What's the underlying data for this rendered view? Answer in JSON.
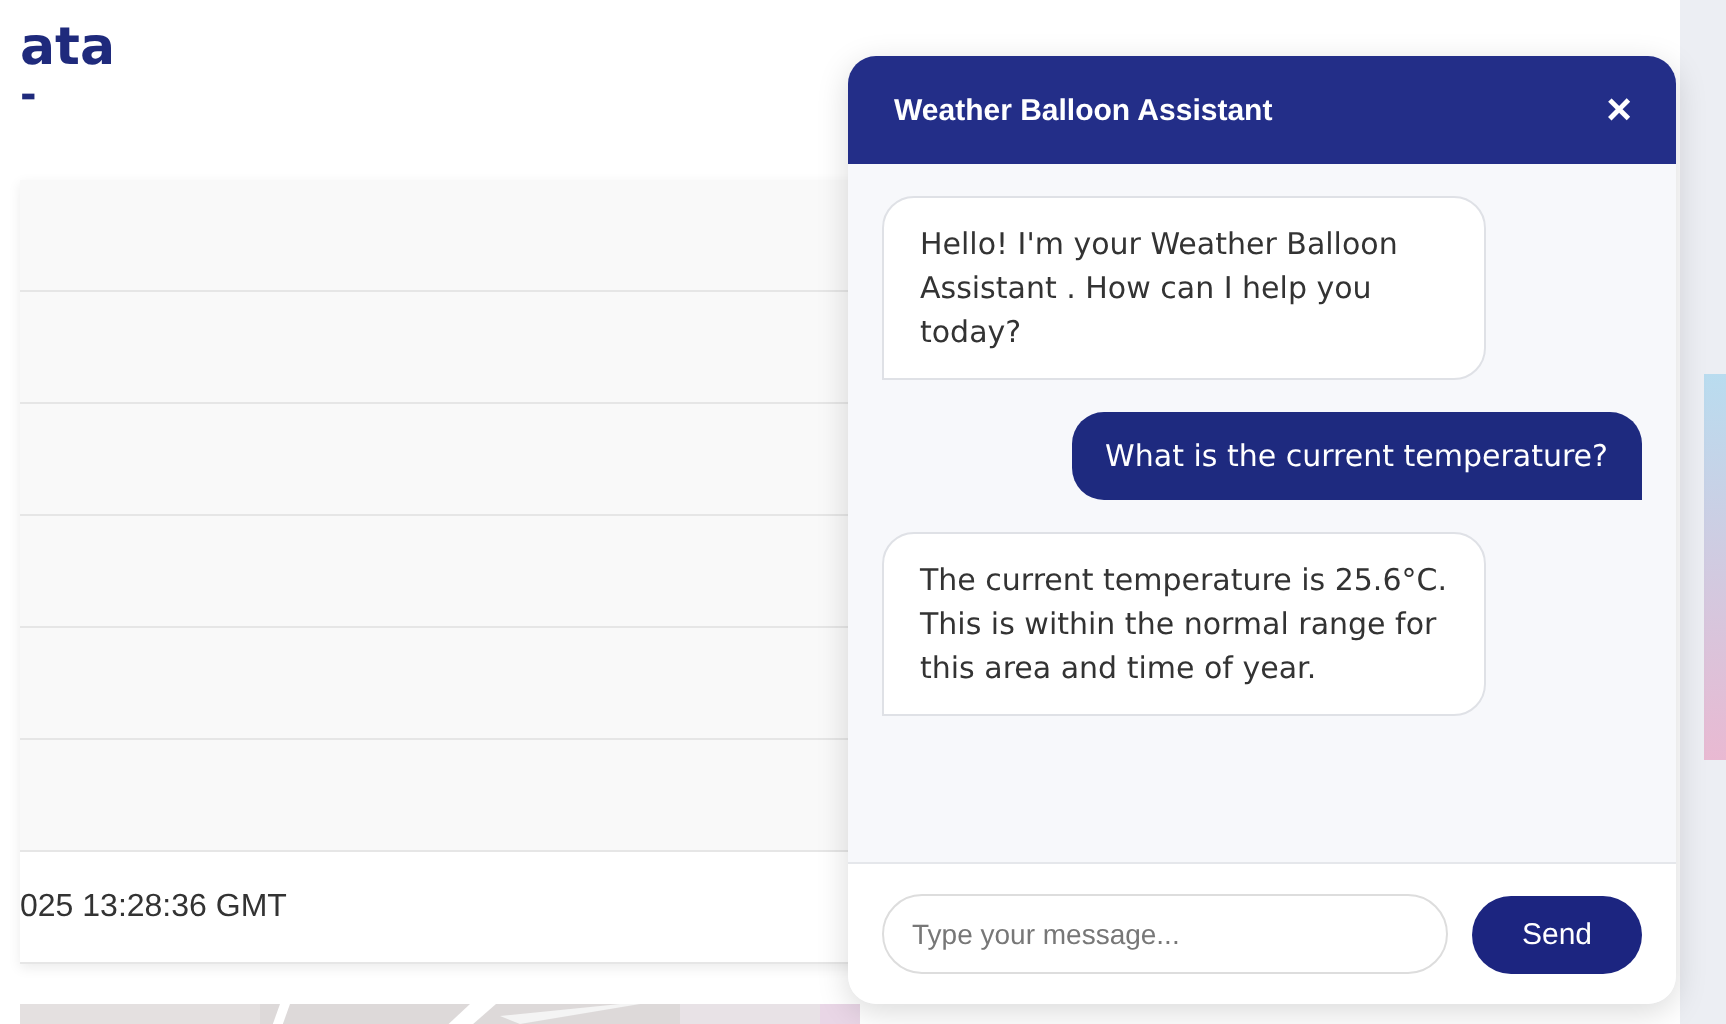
{
  "page": {
    "title": "ata",
    "title_mark": "-"
  },
  "table": {
    "cells": [
      "025 13:28:36 GMT"
    ]
  },
  "chat": {
    "title": "Weather Balloon Assistant",
    "close": "×",
    "messages": [
      {
        "kind": "bot",
        "text": "Hello! I'm your Weather Balloon Assistant . How can I help you today?"
      },
      {
        "kind": "user",
        "text": "What is the current temperature?"
      },
      {
        "kind": "bot",
        "text": "The current temperature is 25.6°C. This is within the normal range for this area and time of year."
      }
    ],
    "input": {
      "placeholder": "Type your message..."
    },
    "send": "Send"
  }
}
